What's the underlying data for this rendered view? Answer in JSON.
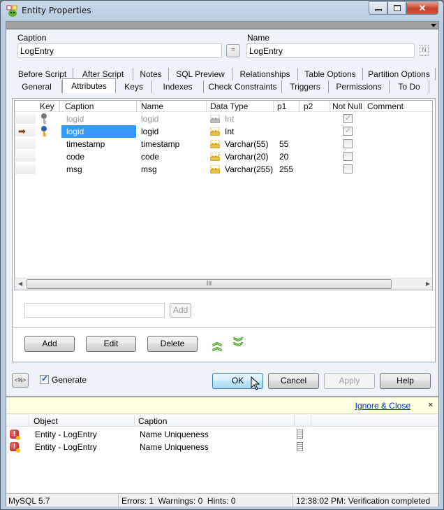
{
  "window": {
    "title": "Entity Properties",
    "icons": {
      "app": "entity-app-icon",
      "minimize": "minimize-icon",
      "maximize": "maximize-icon",
      "close": "close-icon"
    }
  },
  "header": {
    "caption_label": "Caption",
    "caption_value": "LogEntry",
    "equals_label": "=",
    "name_label": "Name",
    "name_value": "LogEntry",
    "naming_button_label": "N"
  },
  "tabs": {
    "row_back": [
      "Before Script",
      "After Script",
      "Notes",
      "SQL Preview",
      "Relationships",
      "Table Options",
      "Partition Options"
    ],
    "row_front": [
      "General",
      "Attributes",
      "Keys",
      "Indexes",
      "Check Constraints",
      "Triggers",
      "Permissions",
      "To Do"
    ],
    "active": "Attributes"
  },
  "attributes_grid": {
    "columns": [
      "Key",
      "Caption",
      "Name",
      "Data Type",
      "p1",
      "p2",
      "Not Null",
      "Comment"
    ],
    "rows": [
      {
        "key_icon": "grey-key-icon",
        "caption": "logid",
        "name": "logid",
        "data_type": "Int",
        "p1": "",
        "p2": "",
        "not_null": true,
        "comment": "",
        "inherited": true,
        "current": false,
        "selected": false
      },
      {
        "key_icon": "primary-key-icon",
        "caption": "logid",
        "name": "logid",
        "data_type": "Int",
        "p1": "",
        "p2": "",
        "not_null": true,
        "comment": "",
        "inherited": false,
        "current": true,
        "selected": true
      },
      {
        "key_icon": "",
        "caption": "timestamp",
        "name": "timestamp",
        "data_type": "Varchar(55)",
        "p1": "55",
        "p2": "",
        "not_null": false,
        "comment": "",
        "inherited": false,
        "current": false,
        "selected": false
      },
      {
        "key_icon": "",
        "caption": "code",
        "name": "code",
        "data_type": "Varchar(20)",
        "p1": "20",
        "p2": "",
        "not_null": false,
        "comment": "",
        "inherited": false,
        "current": false,
        "selected": false
      },
      {
        "key_icon": "",
        "caption": "msg",
        "name": "msg",
        "data_type": "Varchar(255)",
        "p1": "255",
        "p2": "",
        "not_null": false,
        "comment": "",
        "inherited": false,
        "current": false,
        "selected": false
      }
    ],
    "scrollbar_grip": "III"
  },
  "quick_add": {
    "value": "",
    "button_label": "Add"
  },
  "actions": {
    "add": "Add",
    "edit": "Edit",
    "delete": "Delete",
    "move_up": "move-up-icon",
    "move_down": "move-down-icon"
  },
  "footer": {
    "code_button_label": "<%>",
    "generate_label": "Generate",
    "generate_checked": true,
    "ok": "OK",
    "cancel": "Cancel",
    "apply": "Apply",
    "help": "Help"
  },
  "infobar": {
    "link": "Ignore & Close",
    "close": "×"
  },
  "messages": {
    "columns": [
      "Object",
      "Caption"
    ],
    "rows": [
      {
        "icon": "error-icon",
        "object": "Entity - LogEntry",
        "caption": "Name Uniqueness"
      },
      {
        "icon": "error-icon",
        "object": "Entity - LogEntry",
        "caption": "Name Uniqueness"
      }
    ]
  },
  "statusbar": {
    "database": "MySQL 5.7",
    "counts": "Errors: 1  Warnings: 0  Hints: 0",
    "message": "12:38:02 PM: Verification completed"
  }
}
